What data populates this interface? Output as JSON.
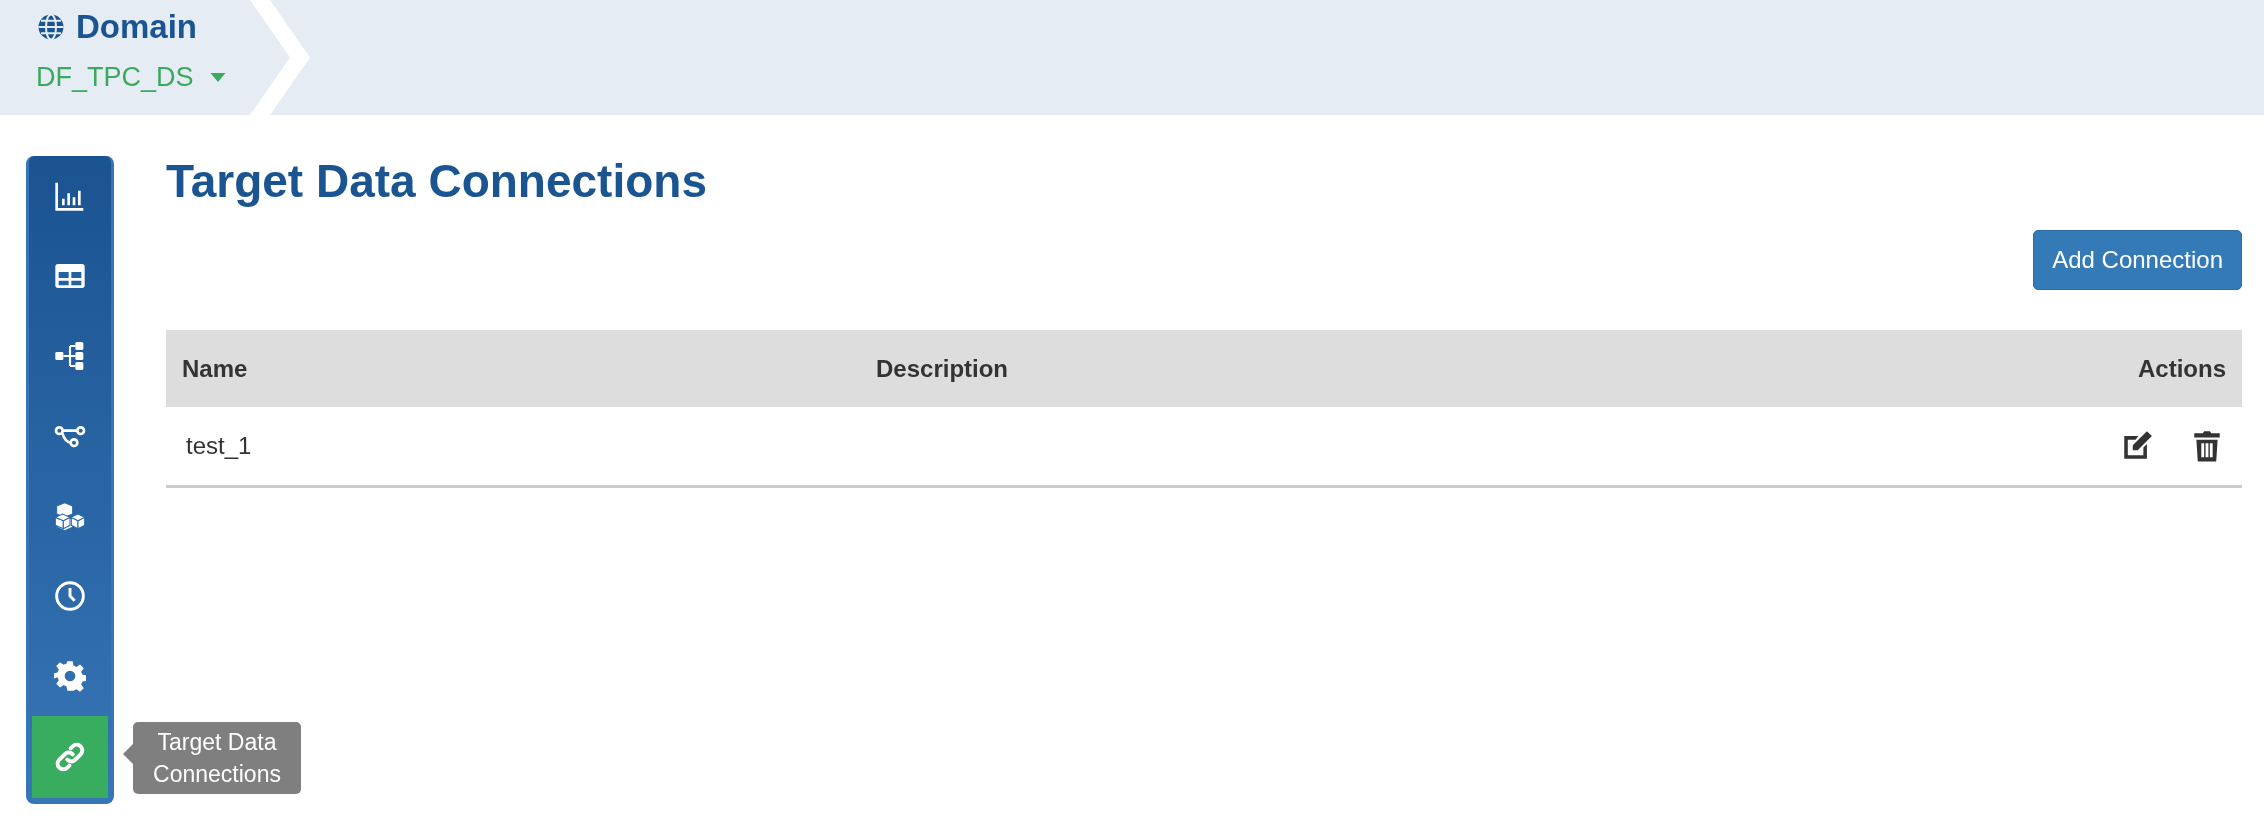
{
  "header": {
    "title": "Domain",
    "domain": "DF_TPC_DS"
  },
  "sidebar": {
    "items": [
      {
        "kind": "chart",
        "selected": false
      },
      {
        "kind": "table",
        "selected": false
      },
      {
        "kind": "tree",
        "selected": false
      },
      {
        "kind": "branch",
        "selected": false
      },
      {
        "kind": "cubes",
        "selected": false
      },
      {
        "kind": "clock",
        "selected": false
      },
      {
        "kind": "gear",
        "selected": false
      },
      {
        "kind": "link",
        "selected": true,
        "tooltip": "Target Data Connections"
      }
    ]
  },
  "page": {
    "title": "Target Data Connections",
    "add_button": "Add Connection"
  },
  "table": {
    "columns": [
      "Name",
      "Description",
      "Actions"
    ],
    "rows": [
      {
        "name": "test_1",
        "actions": [
          {
            "kind": "edit"
          },
          {
            "kind": "delete"
          }
        ]
      }
    ]
  }
}
